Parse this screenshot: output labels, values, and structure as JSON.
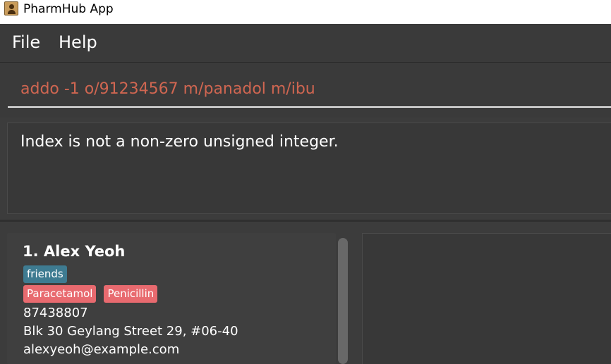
{
  "window": {
    "title": "PharmHub App",
    "icon": "contact-app-icon"
  },
  "menu": {
    "file": "File",
    "help": "Help"
  },
  "command": {
    "value": "addo -1 o/91234567 m/panadol m/ibu"
  },
  "result": {
    "message": "Index is not a non-zero unsigned integer."
  },
  "persons": [
    {
      "index_name": "1.  Alex Yeoh",
      "tags": [
        "friends"
      ],
      "allergies": [
        "Paracetamol",
        "Penicillin"
      ],
      "phone": "87438807",
      "address": "Blk 30 Geylang Street 29, #06-40",
      "email": "alexyeoh@example.com"
    }
  ],
  "colors": {
    "error_text": "#d06651",
    "tag": "#3e7b91",
    "allergy_tag": "#e86a6f"
  }
}
